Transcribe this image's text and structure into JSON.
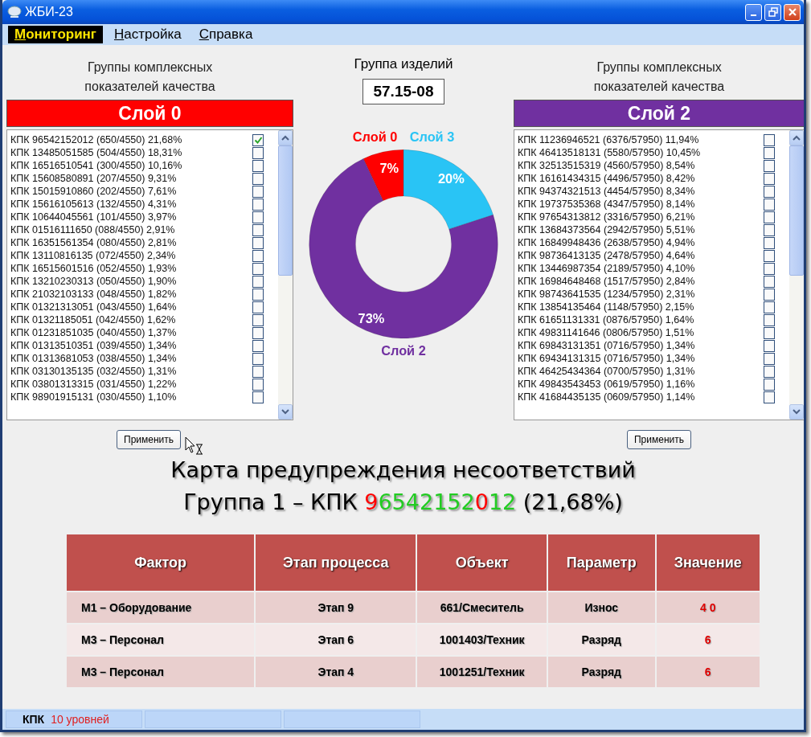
{
  "window": {
    "title": "ЖБИ-23"
  },
  "menu": [
    {
      "label": "Мониторинг",
      "selected": true
    },
    {
      "label": "Настройка",
      "selected": false
    },
    {
      "label": "Справка",
      "selected": false
    }
  ],
  "left_panel": {
    "heading": "Группы комплексных показателей качества",
    "layer": "Слой 0",
    "color": "#ff0000",
    "button": "Применить",
    "items": [
      {
        "text": "КПК 96542152012 (650/4550) 21,68%",
        "checked": true
      },
      {
        "text": "КПК 13485051585 (504/4550) 18,31%",
        "checked": false
      },
      {
        "text": "КПК 16516510541 (300/4550) 10,16%",
        "checked": false
      },
      {
        "text": "КПК 15608580891 (207/4550) 9,31%",
        "checked": false
      },
      {
        "text": "КПК 15015910860 (202/4550) 7,61%",
        "checked": false
      },
      {
        "text": "КПК 15616105613 (132/4550) 4,31%",
        "checked": false
      },
      {
        "text": "КПК 10644045561 (101/4550) 3,97%",
        "checked": false
      },
      {
        "text": "КПК 01516111650 (088/4550) 2,91%",
        "checked": false
      },
      {
        "text": "КПК 16351561354 (080/4550) 2,81%",
        "checked": false
      },
      {
        "text": "КПК 13110816135 (072/4550) 2,34%",
        "checked": false
      },
      {
        "text": "КПК 16515601516 (052/4550) 1,93%",
        "checked": false
      },
      {
        "text": "КПК 13210230313 (050/4550) 1,90%",
        "checked": false
      },
      {
        "text": "КПК 21032103133 (048/4550) 1,82%",
        "checked": false
      },
      {
        "text": "КПК 01321313051 (043/4550) 1,64%",
        "checked": false
      },
      {
        "text": "КПК 01321185051 (042/4550) 1,62%",
        "checked": false
      },
      {
        "text": "КПК 01231851035 (040/4550) 1,37%",
        "checked": false
      },
      {
        "text": "КПК 01313510351 (039/4550) 1,34%",
        "checked": false
      },
      {
        "text": "КПК 01313681053 (038/4550) 1,34%",
        "checked": false
      },
      {
        "text": "КПК 03130135135 (032/4550) 1,31%",
        "checked": false
      },
      {
        "text": "КПК 03801313315 (031/4550) 1,22%",
        "checked": false
      },
      {
        "text": "КПК 98901915131 (030/4550) 1,10%",
        "checked": false
      }
    ]
  },
  "product_group": {
    "label": "Группа изделий",
    "value": "57.15-08"
  },
  "chart_data": {
    "type": "donut",
    "categories": [
      "Слой 0",
      "Слой 3",
      "Слой 2"
    ],
    "values": [
      7,
      20,
      73
    ],
    "colors": [
      "#ff0000",
      "#29c4f5",
      "#7030a0"
    ],
    "value_labels": [
      "7%",
      "20%",
      "73%"
    ]
  },
  "right_panel": {
    "heading": "Группы комплексных показателей качества",
    "layer": "Слой 2",
    "color": "#7030a0",
    "button": "Применить",
    "items": [
      {
        "text": "КПК 11236946521 (6376/57950) 11,94%",
        "checked": false
      },
      {
        "text": "КПК 46413518131 (5580/57950) 10,45%",
        "checked": false
      },
      {
        "text": "КПК 32513515319 (4560/57950) 8,54%",
        "checked": false
      },
      {
        "text": "КПК 16161434315 (4496/57950) 8,42%",
        "checked": false
      },
      {
        "text": "КПК 94374321513 (4454/57950) 8,34%",
        "checked": false
      },
      {
        "text": "КПК 19737535368 (4347/57950) 8,14%",
        "checked": false
      },
      {
        "text": "КПК 97654313812 (3316/57950) 6,21%",
        "checked": false
      },
      {
        "text": "КПК 13684373564 (2942/57950) 5,51%",
        "checked": false
      },
      {
        "text": "КПК 16849948436 (2638/57950) 4,94%",
        "checked": false
      },
      {
        "text": "КПК 98736413135 (2478/57950) 4,64%",
        "checked": false
      },
      {
        "text": "КПК 13446987354 (2189/57950) 4,10%",
        "checked": false
      },
      {
        "text": "КПК 16984648468 (1517/57950) 2,84%",
        "checked": false
      },
      {
        "text": "КПК 98743641535 (1234/57950) 2,31%",
        "checked": false
      },
      {
        "text": "КПК 13854135464 (1148/57950) 2,15%",
        "checked": false
      },
      {
        "text": "КПК 61651131331 (0876/57950) 1,64%",
        "checked": false
      },
      {
        "text": "КПК 49831141646 (0806/57950) 1,51%",
        "checked": false
      },
      {
        "text": "КПК 69843131351 (0716/57950) 1,34%",
        "checked": false
      },
      {
        "text": "КПК 69434131315 (0716/57950) 1,34%",
        "checked": false
      },
      {
        "text": "КПК 46425434364 (0700/57950) 1,31%",
        "checked": false
      },
      {
        "text": "КПК 49843543453 (0619/57950) 1,16%",
        "checked": false
      },
      {
        "text": "КПК 41684435135 (0609/57950) 1,14%",
        "checked": false
      }
    ]
  },
  "warning_map": {
    "title": "Карта предупреждения несоответствий",
    "subtitle_parts": [
      {
        "text": "Группа 1 – КПК ",
        "color": "#000000"
      },
      {
        "text": "9",
        "color": "#ff0000"
      },
      {
        "text": "6542152",
        "color": "#22cc22"
      },
      {
        "text": "0",
        "color": "#ff0000"
      },
      {
        "text": "12",
        "color": "#22cc22"
      },
      {
        "text": " (21,68%)",
        "color": "#000000"
      }
    ]
  },
  "table": {
    "columns": [
      "Фактор",
      "Этап процесса",
      "Объект",
      "Параметр",
      "Значение"
    ],
    "rows": [
      [
        "М1 –  Оборудование",
        "Этап 9",
        "661/Смеситель",
        "Износ",
        "4 0"
      ],
      [
        "М3 – Персонал",
        "Этап 6",
        "1001403/Техник",
        "Разряд",
        "6"
      ],
      [
        "М3 – Персонал",
        "Этап 4",
        "1001251/Техник",
        "Разряд",
        "6"
      ]
    ]
  },
  "status_bar": {
    "label": "КПК",
    "value": "10 уровней"
  }
}
